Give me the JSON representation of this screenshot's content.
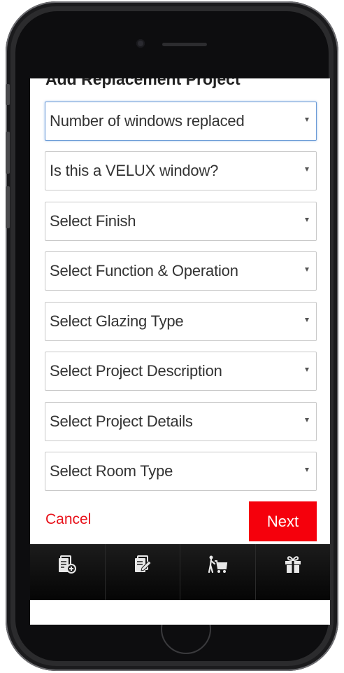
{
  "page": {
    "title": "Add Replacement Project"
  },
  "form": {
    "fields": [
      {
        "label": "Number of windows replaced",
        "focused": true
      },
      {
        "label": "Is this a VELUX window?",
        "focused": false
      },
      {
        "label": "Select Finish",
        "focused": false
      },
      {
        "label": "Select Function & Operation",
        "focused": false
      },
      {
        "label": "Select Glazing Type",
        "focused": false
      },
      {
        "label": "Select Project Description",
        "focused": false
      },
      {
        "label": "Select Project Details",
        "focused": false
      },
      {
        "label": "Select Room Type",
        "focused": false
      }
    ],
    "cancel_label": "Cancel",
    "next_label": "Next"
  },
  "tabbar": {
    "items": [
      {
        "icon": "add-document-icon"
      },
      {
        "icon": "edit-document-icon"
      },
      {
        "icon": "shopping-cart-icon"
      },
      {
        "icon": "gift-icon"
      }
    ]
  },
  "colors": {
    "accent": "#f5000c",
    "cancel_text": "#e8121b",
    "focus_border": "#6b9bd6",
    "tabbar_bg": "#111111"
  }
}
